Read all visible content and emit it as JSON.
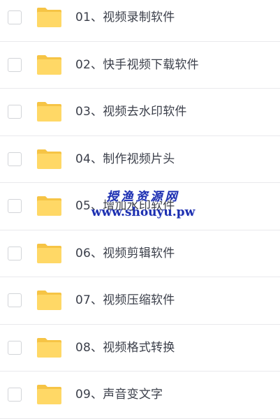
{
  "items": [
    {
      "label": "01、视频录制软件",
      "icon": "folder-icon",
      "checked": false
    },
    {
      "label": "02、快手视频下载软件",
      "icon": "folder-icon",
      "checked": false
    },
    {
      "label": "03、视频去水印软件",
      "icon": "folder-icon",
      "checked": false
    },
    {
      "label": "04、制作视频片头",
      "icon": "folder-icon",
      "checked": false
    },
    {
      "label": "05、增加水印软件",
      "icon": "folder-icon",
      "checked": false
    },
    {
      "label": "06、视频剪辑软件",
      "icon": "folder-icon",
      "checked": false
    },
    {
      "label": "07、视频压缩软件",
      "icon": "folder-icon",
      "checked": false
    },
    {
      "label": "08、视频格式转换",
      "icon": "folder-icon",
      "checked": false
    },
    {
      "label": "09、声音变文字",
      "icon": "folder-icon",
      "checked": false
    }
  ],
  "watermark": {
    "title": "授渔资源网",
    "url": "www.shouyu.pw"
  },
  "colors": {
    "folder_back": "#f6c445",
    "folder_front": "#ffd866",
    "text": "#3b3f4a",
    "watermark": "#1c2fb0"
  }
}
